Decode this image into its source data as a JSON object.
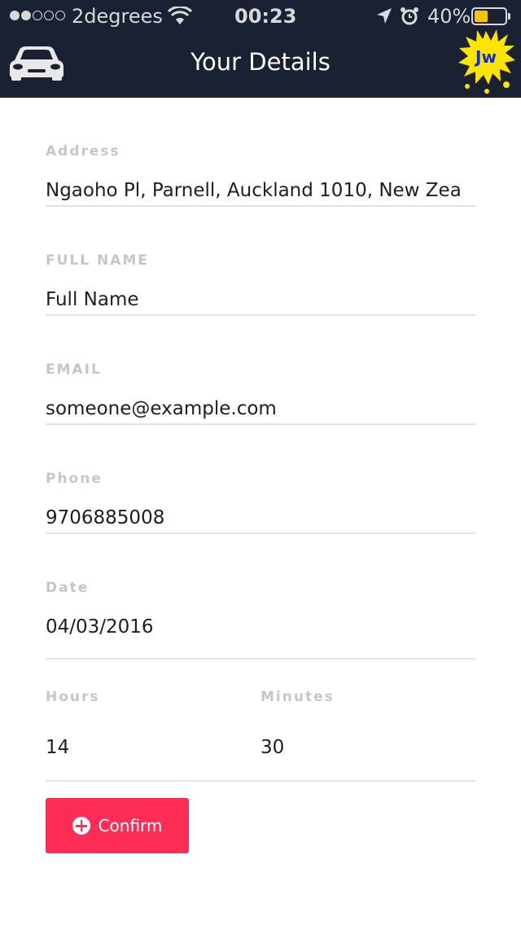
{
  "status_bar": {
    "carrier": "2degrees",
    "time": "00:23",
    "battery_percent": "40%",
    "battery_level": 0.4,
    "signal_bars_filled": 2,
    "signal_bars_total": 5
  },
  "header": {
    "title": "Your Details",
    "left_icon": "car-icon",
    "logo_text": "Jw"
  },
  "form": {
    "address": {
      "label": "Address",
      "value": "Ngaoho Pl, Parnell, Auckland 1010, New Zea"
    },
    "full_name": {
      "label": "FULL NAME",
      "value": "Full Name"
    },
    "email": {
      "label": "EMAIL",
      "value": "someone@example.com"
    },
    "phone": {
      "label": "Phone",
      "value": "9706885008"
    },
    "date": {
      "label": "Date",
      "value": "04/03/2016"
    },
    "hours": {
      "label": "Hours",
      "value": "14"
    },
    "minutes": {
      "label": "Minutes",
      "value": "30"
    }
  },
  "confirm_button": {
    "label": "Confirm",
    "icon": "plus-circle-icon"
  },
  "colors": {
    "header_bg": "#1a2133",
    "accent": "#fe2d55",
    "label": "#c6c6c6",
    "divider": "#e2e2e2",
    "battery": "#f5c400"
  }
}
